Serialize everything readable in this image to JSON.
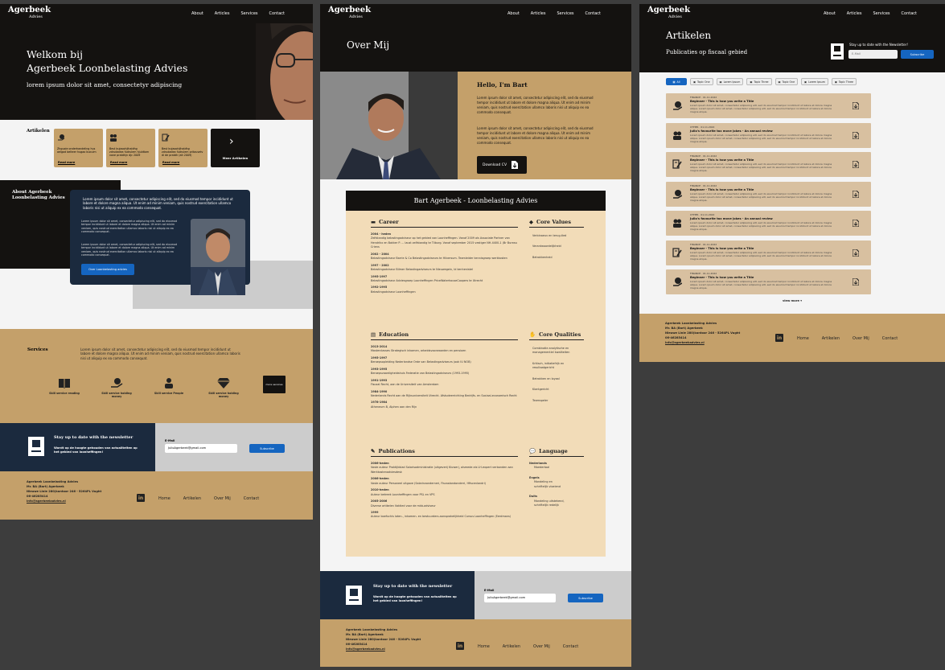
{
  "brand": {
    "name": "Agerbeek",
    "sub": "Advies"
  },
  "nav": [
    "About",
    "Articles",
    "Services",
    "Contact"
  ],
  "home": {
    "hero_title_1": "Welkom bij",
    "hero_title_2": "Agerbeek Loonbelasting Advies",
    "hero_sub": "lorem ipsum dolor sit amet, consectetyr adipiscing",
    "articles_heading": "Artikelen",
    "cards": [
      {
        "icon": "money-hand-icon",
        "text": "Zhguoie onderhandeling hus aelgad belteer hugao bucuim",
        "more": "Read more"
      },
      {
        "icon": "people-icon",
        "text": "Best bujaoohjihaldhg zdrudadea fudrulem hjuldtom vone pratdhjn djc 2009",
        "more": "Read more"
      },
      {
        "icon": "document-pen-icon",
        "text": "Best bujaoohjihaldhg zdrudadea fudrulem pritausetv di de pratdh (alt 2009)",
        "more": "Read more"
      }
    ],
    "more_articles": "Meer Artikelen",
    "about_heading_1": "About Agerbeek",
    "about_heading_2": "Loonbelasting Advies",
    "about_lead": "Lorem ipsum dolor sit amet, consectetur adipiscing elit, sed do eiusmod tempor incididunt ut labore et dolore magna aliqua. Ut enim ad minim veniam, quis nostrud exercitation ullamco laboris nisi ut aliquip ex ea commodo consequat.",
    "about_p1": "Lorem ipsum dolor sit amet, consectetur adipiscing elit, sed do eiusmod tempor incididunt ut labore et dolore magna aliqua. Ut enim ad minim veniam, quis nostrud exercitation ullamco laboris nisi ut aliquip ex ea commodo consequat.",
    "about_p2": "Lorem ipsum dolor sit amet, consectetur adipiscing elit, sed do eiusmod tempor incididunt ut labore et dolore magna aliqua. Ut enim ad minim veniam, quis nostrud exercitation ullamco laboris nisi ut aliquip ex ea commodo consequat.",
    "about_button": "Over Loonbelasting advies",
    "services_heading": "Services",
    "services_text": "Lorem ipsum dolor sit amet, consectetur adipiscing elit, sed do eiusmod tempor incididunt ut labore et dolore magna aliqua. Ut enim ad minim veniam, quis nostrud exercitation ullamco laboris nisi ut aliquip ex ea commodo consequat.",
    "services": [
      {
        "icon": "book-icon",
        "label": "Skill service reading"
      },
      {
        "icon": "money-hand-icon",
        "label": "Skill service holding money"
      },
      {
        "icon": "people-icon",
        "label": "Skill service People"
      },
      {
        "icon": "diamond-icon",
        "label": "Skill service holding money"
      }
    ],
    "services_more": "more services"
  },
  "newsletter": {
    "title": "Stay up to date with the newsletter",
    "text": "Wordt op de hoogte gehouden van actualiteiten op het gebied van loonheffingen!",
    "email_label": "E-Mail",
    "email_value": "JulioAgerbeek@gmail.com",
    "subscribe": "Subscribe"
  },
  "footer": {
    "lines": [
      "Agerbeek Loonbelasting Advies",
      "Mr. BA (Bart) Agerbeek",
      "Nieuwe Linie 280(kantoor 246 - 5264PL Vught",
      "06-46285414",
      "info@agerbeekadvies.nl"
    ],
    "links": [
      "Home",
      "Artikelen",
      "Over Mij",
      "Contact"
    ],
    "linkedin": "in"
  },
  "about": {
    "title": "Over Mij",
    "hello": "Hello, I'm Bart",
    "p1": "Lorem ipsum dolor sit amet, consectetur adipiscing elit, sed do eiusmod tempor incididunt ut labore et dolore magna aliqua. Ut enim ad minim veniam, quis nostrud exercitation ullamco laboris nisi ut aliquip ex ea commodo consequat.",
    "p2": "Lorem ipsum dolor sit amet, consectetur adipiscing elit, sed do eiusmod tempor incididunt ut labore et dolore magna aliqua. Ut enim ad minim veniam, quis nostrud exercitation ullamco laboris nisi ut aliquip ex ea commodo consequat.",
    "download": "Download CV",
    "cv_title": "Bart Agerbeek - Loonbelasting Advies",
    "career_h": "Career",
    "career": [
      {
        "y": "2004 - heden",
        "t": "Zelfstandig belastingadviseur op het gebied van Loonheffingen. Vanaf 2009 als Associate Partner van Hendrikx en Bakker P. ... laust zelfstandig te Tilburg. Vanaf september 2015 vestiger NH-4400-1 (Br Bureau Criens"
      },
      {
        "y": "2002 - 2004",
        "t": "Belastingadviseur Barrie & Co Belastingadviseurs te Hilversum. Teamleider kennisgroep werkkostеn"
      },
      {
        "y": "1997 - 2002",
        "t": "Belastingadviseur Bilmer Belastingadviseurs te Nieuwegein, Id kenhenistel"
      },
      {
        "y": "1995-1997",
        "t": "Belastingadviseur Adviesgroep Loonheffingen PriceWaterhouseCoopers te Utrecht"
      },
      {
        "y": "1992-1995",
        "t": "Belastingadviseur Loonheffingen"
      }
    ],
    "values_h": "Core Values",
    "values": [
      "Verbinaeuv en terug-tled",
      "Verantwoordelijkheid",
      "Betrokkenheid"
    ],
    "edu_h": "Education",
    "edu": [
      {
        "y": "2013-2014",
        "t": "Masterclasses Strategisch inkomen, arbeidsvoorwaarden en pensioen"
      },
      {
        "y": "1995-1997",
        "t": "Beroepsopleiding Nederlandse Orde van Belastingadviseurs (ook IU NOB)"
      },
      {
        "y": "1993-1995",
        "t": "Beroepsvaardigheidshuis Federatie van Belastingadviseurs (1993-1995)"
      },
      {
        "y": "1991-1993",
        "t": "Fiscaal Recht, aan de Universiteit van Amsterdam"
      },
      {
        "y": "1984-1990",
        "t": "Nederlands Recht aan de Rijksuniversiteit Utrecht. Afstudeerrichting Bedrijfs- en Sociaal-economisch Recht"
      },
      {
        "y": "1978-1984",
        "t": "Atheneum B, Alphen aan den Rijn"
      }
    ],
    "qual_h": "Core Qualities",
    "qual": [
      "Combinatie analytische en managementiel kwaliteiten",
      "Kritisch, initiatiefrijk en resultaatgericht",
      "Betrokken en loyaal",
      "Klantgericht",
      "Teamspeler"
    ],
    "pub_h": "Publications",
    "pub": [
      {
        "y": "2006-heden",
        "t": "Vaste auteur Praktijkblad Salarisadministratie (uitgeverij Kluwer), alsmede als LH-expert verbonden aan Werkkostenadviesdesk"
      },
      {
        "y": "2006-heden",
        "t": "Vaste auteur Personeel uitgave (Salarisnonderneri, Fiscaalandonderri, Hfiscenlandri)"
      },
      {
        "y": "2010-heden",
        "t": "Auteur betreek Loonheffingen voor PSL en VPS"
      },
      {
        "y": "2005-2006",
        "t": "Diverse artikelen Vaktied voor de mkb-adviseur"
      },
      {
        "y": "1999",
        "t": "Auteur boefuchis loten-, inkomen- en bestuurders-aansprakelijkheid Cursus Loonheffingen (Eerdmans)"
      }
    ],
    "lang_h": "Language",
    "lang": [
      {
        "n": "Nederlands",
        "d": [
          "Moedertaal"
        ]
      },
      {
        "n": "Engels",
        "d": [
          "Mondeling en",
          "schriftelijk vloeiend"
        ]
      },
      {
        "n": "Duits",
        "d": [
          "Mondeling uitstekend,",
          "schriftelijk redelijk"
        ]
      }
    ]
  },
  "articles": {
    "title": "Artikelen",
    "subtitle": "Publicaties op fiscaal gebied",
    "stay": "Stay up to date with the Newsletter!",
    "email_placeholder": "E-Mail",
    "subscribe": "Subscribe",
    "filters": [
      "All",
      "Topic One",
      "Lorem Ipsum",
      "Topic Three",
      "Topic One",
      "Lorem Ipsum",
      "Topic Three"
    ],
    "items": [
      {
        "icon": "money-hand-icon",
        "meta": "FINANCE · 01.11.2022",
        "title": "Beginner - This is how you write a Title"
      },
      {
        "icon": "people-icon",
        "meta": "OTHER · 01.11.2022",
        "title": "Julio's favourite tax move jokes - An annual review"
      },
      {
        "icon": "document-pen-icon",
        "meta": "FINANCE · 01.11.2022",
        "title": "Beginner - This is how you write a Title"
      },
      {
        "icon": "money-hand-icon",
        "meta": "FINANCE · 01.11.2022",
        "title": "Beginner - This is how you write a Title"
      },
      {
        "icon": "people-icon",
        "meta": "OTHER · 01.11.2022",
        "title": "Julio's favourite tax move jokes - An annual review"
      },
      {
        "icon": "document-pen-icon",
        "meta": "FINANCE · 01.11.2022",
        "title": "Beginner - This is how you write a Title"
      },
      {
        "icon": "money-hand-icon",
        "meta": "FINANCE · 01.11.2022",
        "title": "Beginner - This is how you write a Title"
      }
    ],
    "item_text": "Lorem ipsum dolor sit amet, consectetur adipiscing elit, sed do eiusmod tempor incididunt ut labore et dolore magna aliqua. Lorem ipsum dolor sit amet, consectetur adipiscing elit, sed do eiusmod tempor incididunt ut labore et dolore magna aliqua.",
    "view_more": "view more"
  }
}
